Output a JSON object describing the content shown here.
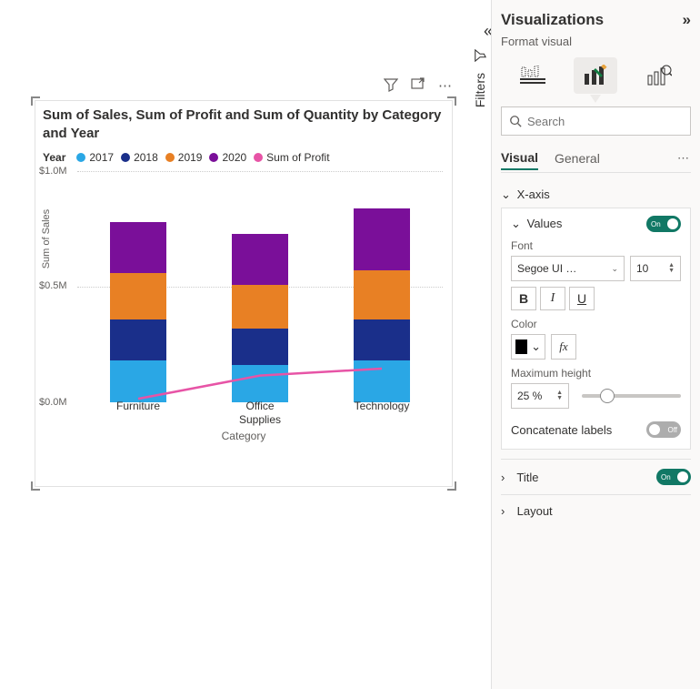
{
  "filters": {
    "label": "Filters"
  },
  "panel": {
    "title": "Visualizations",
    "subtitle": "Format visual",
    "search_placeholder": "Search",
    "tabs": {
      "visual": "Visual",
      "general": "General"
    },
    "sections": {
      "xaxis": "X-axis",
      "values": "Values",
      "title_section": "Title",
      "layout": "Layout"
    },
    "values": {
      "font_label": "Font",
      "font_family": "Segoe UI …",
      "font_size": "10",
      "color_label": "Color",
      "maxheight_label": "Maximum height",
      "maxheight_value": "25 %",
      "concat_label": "Concatenate labels",
      "toggle_on": "On",
      "toggle_off": "Off",
      "fx": "fx",
      "bold": "B",
      "italic": "I",
      "underline": "U"
    }
  },
  "chart": {
    "title": "Sum of Sales, Sum of Profit and Sum of Quantity by Category and Year",
    "legend_title": "Year",
    "y_axis_title": "Sum of Sales",
    "x_axis_title": "Category",
    "yticks": [
      "$1.0M",
      "$0.5M",
      "$0.0M"
    ],
    "categories": [
      "Furniture",
      "Office Supplies",
      "Technology"
    ]
  },
  "chart_data": {
    "type": "bar",
    "title": "Sum of Sales, Sum of Profit and Sum of Quantity by Category and Year",
    "xlabel": "Category",
    "ylabel": "Sum of Sales",
    "ylim": [
      0,
      1000000
    ],
    "categories": [
      "Furniture",
      "Office Supplies",
      "Technology"
    ],
    "series": [
      {
        "name": "2017",
        "color": "#2aa7e5",
        "values": [
          180000,
          160000,
          180000
        ]
      },
      {
        "name": "2018",
        "color": "#1a2f8a",
        "values": [
          180000,
          160000,
          180000
        ]
      },
      {
        "name": "2019",
        "color": "#e88024",
        "values": [
          200000,
          190000,
          210000
        ]
      },
      {
        "name": "2020",
        "color": "#7a0f99",
        "values": [
          220000,
          220000,
          270000
        ]
      },
      {
        "name": "Sum of Profit",
        "color": "#e754a6",
        "type": "line",
        "values": [
          20000,
          120000,
          150000
        ]
      }
    ]
  }
}
